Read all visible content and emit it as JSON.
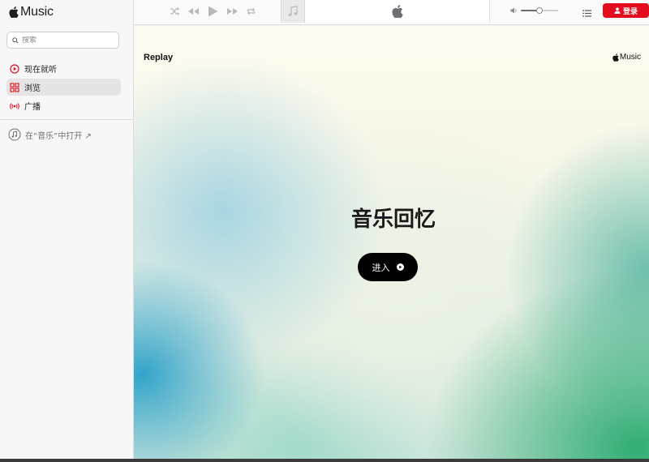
{
  "sidebar": {
    "brand": "Music",
    "search": {
      "placeholder": "搜索",
      "value": ""
    },
    "items": [
      {
        "label": "现在就听",
        "icon": "play-circle-icon",
        "active": false
      },
      {
        "label": "浏览",
        "icon": "grid-icon",
        "active": true
      },
      {
        "label": "广播",
        "icon": "radio-icon",
        "active": false
      }
    ],
    "open_in_app": "在“音乐”中打开 ↗"
  },
  "player": {
    "volume_level": 0.5,
    "signin_label": "登录"
  },
  "hero": {
    "replay": "Replay",
    "brand": "Music",
    "title": "音乐回忆",
    "enter_label": "进入"
  },
  "colors": {
    "accent": "#e30d1e",
    "nav_active_bg": "#e4e4e4",
    "enter_button": "#000000"
  }
}
